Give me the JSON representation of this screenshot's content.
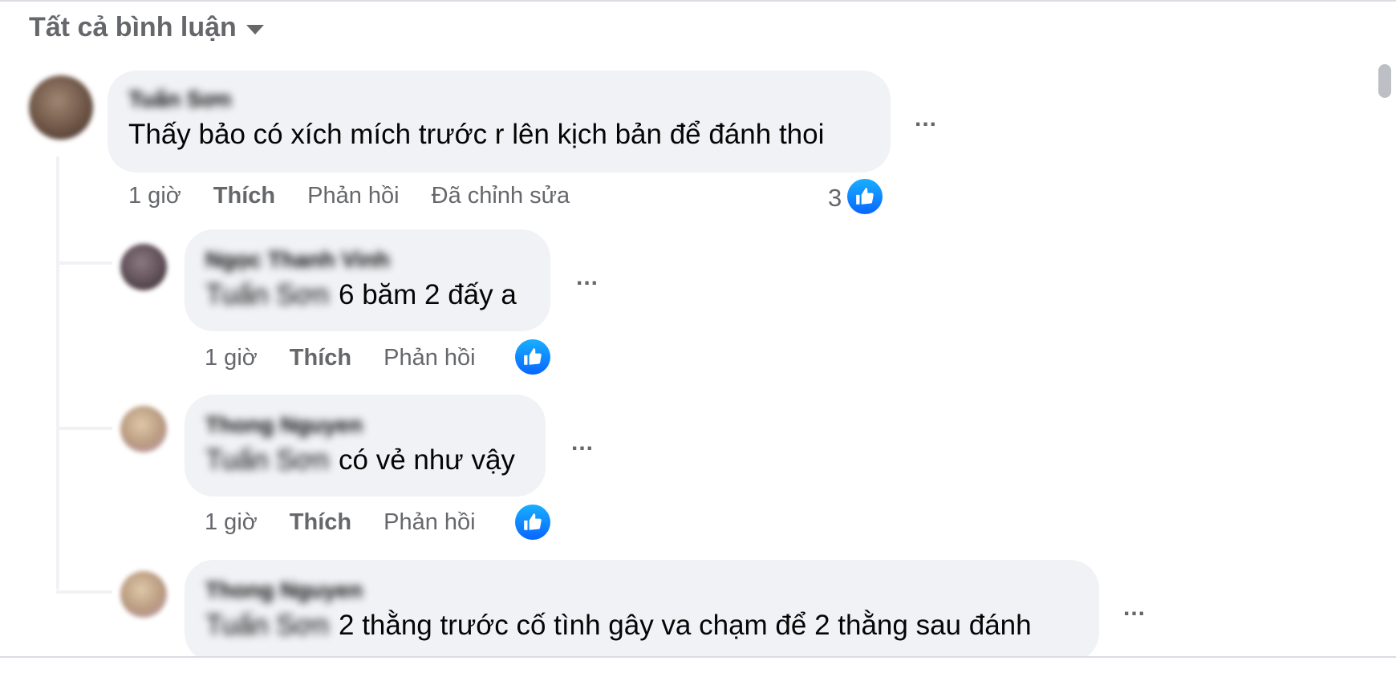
{
  "header": {
    "filter_label": "Tất cả bình luận",
    "caret_icon": "caret-down-icon"
  },
  "comments": [
    {
      "author": "Tuấn Sơn",
      "text": "Thấy bảo có xích mích trước r lên kịch bản để đánh thoi",
      "time": "1 giờ",
      "like_label": "Thích",
      "reply_label": "Phản hồi",
      "edited_label": "Đã chỉnh sửa",
      "reaction_count": "3",
      "reaction_icon": "like-icon",
      "more_label": "..."
    }
  ],
  "replies": [
    {
      "author": "Ngọc Thanh Vinh",
      "mention": "Tuấn Sơn",
      "text": "6 băm 2 đấy a",
      "time": "1 giờ",
      "like_label": "Thích",
      "reply_label": "Phản hồi",
      "reaction_icon": "like-icon",
      "more_label": "..."
    },
    {
      "author": "Thong Nguyen",
      "mention": "Tuấn Sơn",
      "text": "có vẻ như vậy",
      "time": "1 giờ",
      "like_label": "Thích",
      "reply_label": "Phản hồi",
      "reaction_icon": "like-icon",
      "more_label": "..."
    },
    {
      "author": "Thong Nguyen",
      "mention": "Tuấn Sơn",
      "text": "2 thằng trước cố tình gây va chạm để 2 thằng sau đánh",
      "more_label": "..."
    }
  ],
  "colors": {
    "bubble": "#f0f2f5",
    "secondary_text": "#65676b",
    "like_blue": "#0866ff"
  }
}
